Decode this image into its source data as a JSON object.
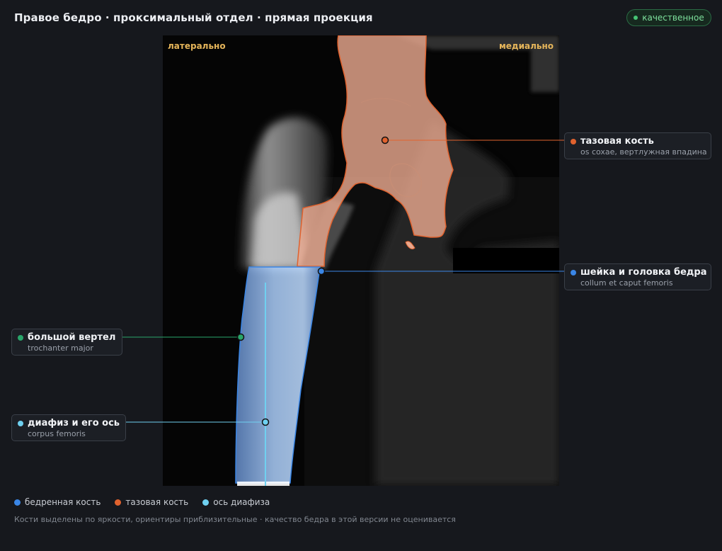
{
  "header": {
    "title": "Правое бедро · проксимальный отдел · прямая проекция",
    "badge": "качественное"
  },
  "viewer": {
    "orientation_left": "латерально",
    "orientation_right": "медиально"
  },
  "annotations": [
    {
      "id": "pelvis",
      "label": "тазовая кость",
      "sublabel": "os coxae, вертлужная впадина",
      "color": "#e0622e"
    },
    {
      "id": "neck",
      "label": "шейка и головка бедра",
      "sublabel": "collum et caput femoris",
      "color": "#3a86e6"
    },
    {
      "id": "trochanter",
      "label": "большой вертел",
      "sublabel": "trochanter major",
      "color": "#29a66a"
    },
    {
      "id": "shaft",
      "label": "диафиз и его ось",
      "sublabel": "corpus femoris",
      "color": "#6fd0f0"
    }
  ],
  "legend": [
    {
      "label": "бедренная кость",
      "color": "#3a86e6"
    },
    {
      "label": "тазовая кость",
      "color": "#e0622e"
    },
    {
      "label": "ось диафиза",
      "color": "#6fd0f0"
    }
  ],
  "footnote": "Кости выделены по яркости, ориентиры приблизительные · качество бедра в этой версии не оценивается"
}
